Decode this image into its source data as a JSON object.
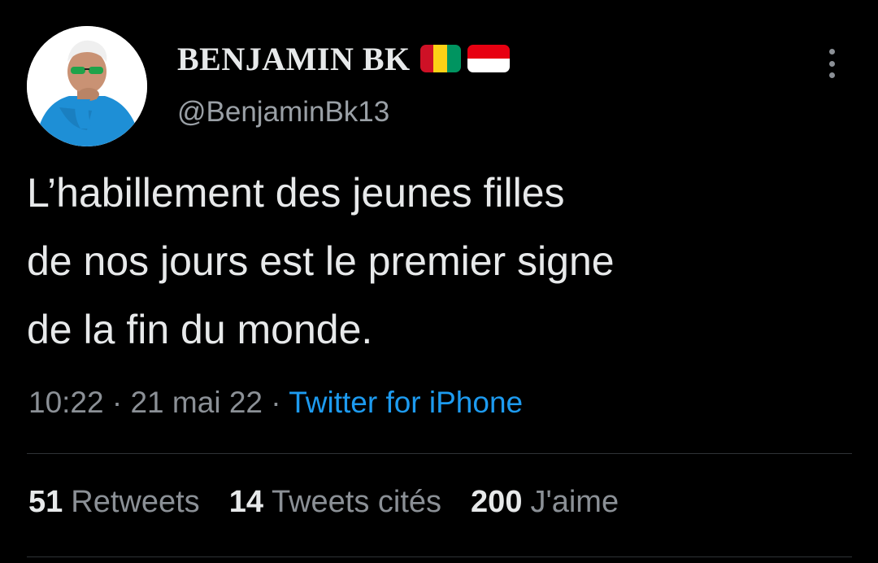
{
  "user": {
    "display_name": "BENJAMIN BK",
    "handle": "@BenjaminBk13",
    "flags": [
      "guinea-flag",
      "indonesia-flag"
    ]
  },
  "colors": {
    "background": "#000000",
    "text": "#e7e9ea",
    "muted": "#8b9096",
    "link": "#1d9bf0",
    "divider": "#2f3336"
  },
  "tweet": {
    "text_lines": [
      "L’habillement des jeunes filles",
      "de nos jours est le premier signe",
      "de la fin du monde."
    ]
  },
  "meta": {
    "time": "10:22",
    "separator": " · ",
    "date": "21 mai 22",
    "source": "Twitter for iPhone"
  },
  "stats": {
    "retweets_count": "51",
    "retweets_label": "Retweets",
    "quotes_count": "14",
    "quotes_label": "Tweets cités",
    "likes_count": "200",
    "likes_label": "J'aime"
  }
}
